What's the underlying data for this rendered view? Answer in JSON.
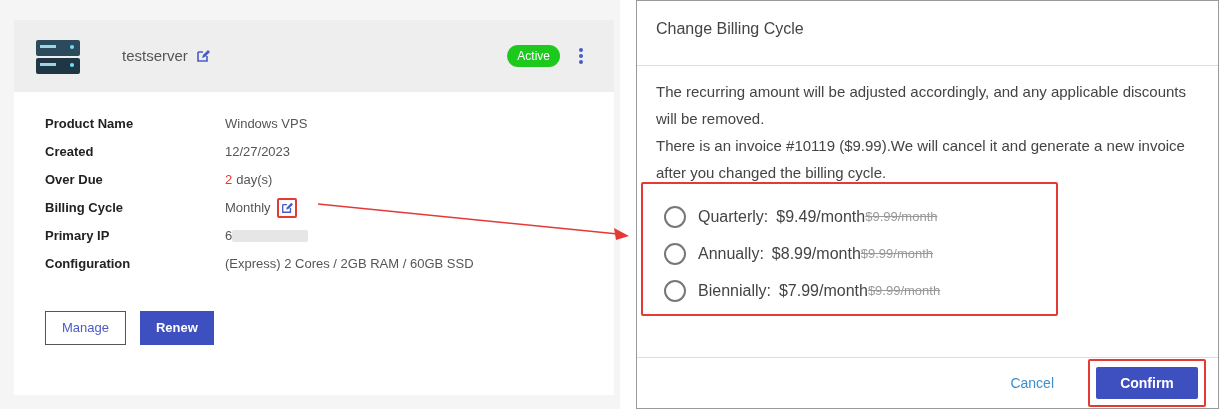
{
  "service_card": {
    "name": "testserver",
    "status": "Active",
    "details": [
      {
        "label": "Product Name",
        "kind": "text",
        "value": "Windows VPS"
      },
      {
        "label": "Created",
        "kind": "text",
        "value": "12/27/2023"
      },
      {
        "label": "Over Due",
        "kind": "overdue",
        "count": "2",
        "value": "day(s)"
      },
      {
        "label": "Billing Cycle",
        "kind": "editable",
        "value": "Monthly",
        "highlighted": true
      },
      {
        "label": "Primary IP",
        "kind": "redacted",
        "value": "6"
      },
      {
        "label": "Configuration",
        "kind": "text",
        "value": "(Express) 2 Cores / 2GB RAM / 60GB SSD"
      }
    ],
    "buttons": [
      {
        "label": "Manage",
        "kind": "outline"
      },
      {
        "label": "Renew",
        "kind": "primary"
      }
    ]
  },
  "dialog": {
    "title": "Change Billing Cycle",
    "message": [
      "The recurring amount will be adjusted accordingly, and any applicable discounts will be removed.",
      "There is an invoice #10119 ($9.99).We will cancel it and generate a new invoice after you changed the billing cycle."
    ],
    "options": [
      {
        "label": "Quarterly:",
        "price": "$9.49/month",
        "old_price": "$9.99/month",
        "selected": false
      },
      {
        "label": "Annually:",
        "price": "$8.99/month",
        "old_price": "$9.99/month",
        "selected": false
      },
      {
        "label": "Biennially:",
        "price": "$7.99/month",
        "old_price": "$9.99/month",
        "selected": false
      }
    ],
    "options_highlighted": true,
    "buttons": [
      {
        "label": "Cancel",
        "kind": "link"
      },
      {
        "label": "Confirm",
        "kind": "primary",
        "highlighted": true
      }
    ]
  }
}
